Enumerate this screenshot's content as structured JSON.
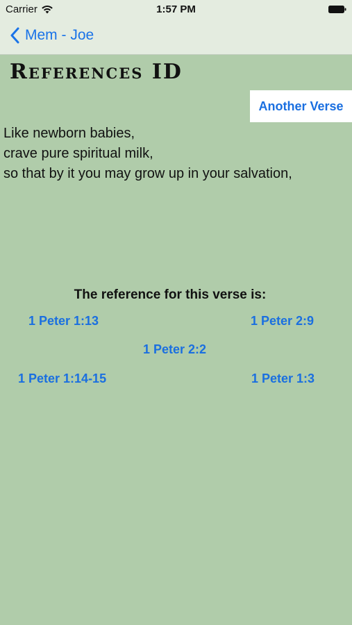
{
  "status_bar": {
    "carrier": "Carrier",
    "time": "1:57 PM"
  },
  "nav": {
    "back_label": "Mem - Joe"
  },
  "page": {
    "title": "References ID",
    "another_verse_label": "Another Verse"
  },
  "verse": {
    "lines": [
      "Like newborn babies,",
      "crave pure spiritual milk,",
      "so that by it you may grow up in your salvation,"
    ]
  },
  "quiz": {
    "prompt": "The reference for this verse is:",
    "choices": [
      "1 Peter 1:13",
      "1 Peter 2:9",
      "1 Peter 2:2",
      "1 Peter 1:14-15",
      "1 Peter 1:3"
    ]
  },
  "colors": {
    "background": "#b0ccaa",
    "nav_background": "#e4ece0",
    "accent": "#1a6fe0"
  }
}
